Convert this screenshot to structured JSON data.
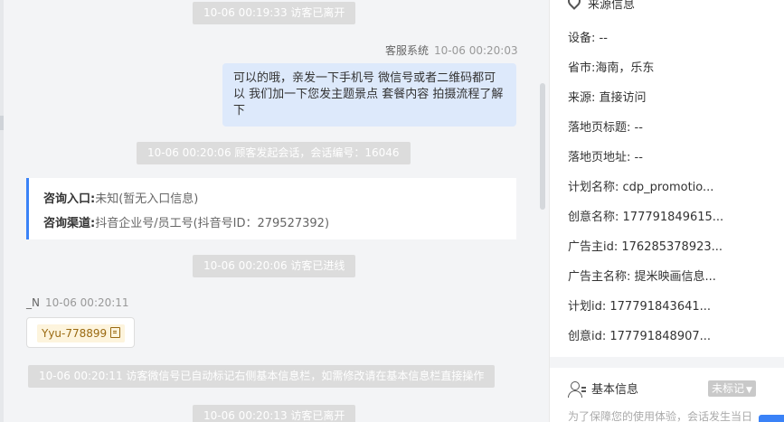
{
  "chat": {
    "system_top": "10-06 00:19:33 访客已离开",
    "agent_name": "客服系统",
    "agent_time": "10-06 00:20:03",
    "agent_message": "可以的哦，亲发一下手机号 微信号或者二维码都可以 我们加一下您发主题景点 套餐内容 拍摄流程了解下",
    "session_start": "10-06 00:20:06 顾客发起会话，会话编号：16046",
    "card": {
      "entry_label": "咨询入口:",
      "entry_value": "未知(暂无入口信息)",
      "channel_label": "咨询渠道:",
      "channel_value": "抖音企业号/员工号(抖音号ID：279527392)"
    },
    "visitor_enter": "10-06 00:20:06 访客已进线",
    "visitor_name": "_N",
    "visitor_time": "10-06 00:20:11",
    "wechat_tag": "Yyu-778899",
    "auto_mark": "10-06 00:20:11 访客微信号已自动标记右侧基本信息栏，如需修改请在基本信息栏直接操作",
    "system_bottom": "10-06 00:20:13 访客已离开"
  },
  "side": {
    "source_title": "来源信息",
    "rows": [
      {
        "k": "设备:",
        "v": "--"
      },
      {
        "k": "省市:",
        "v": "海南，乐东"
      },
      {
        "k": "来源:",
        "v": "直接访问"
      },
      {
        "k": "落地页标题:",
        "v": "--"
      },
      {
        "k": "落地页地址:",
        "v": "--"
      },
      {
        "k": "计划名称:",
        "v": "cdp_promotio..."
      },
      {
        "k": "创意名称:",
        "v": "177791849615..."
      },
      {
        "k": "广告主id:",
        "v": "176285378923..."
      },
      {
        "k": "广告主名称:",
        "v": "提米映画信息..."
      },
      {
        "k": "计划id:",
        "v": "177791843641..."
      },
      {
        "k": "创意id:",
        "v": "177791848907..."
      }
    ],
    "basic_title": "基本信息",
    "unmarked_label": "未标记",
    "tip": "为了保障您的使用体验，会话发生当日"
  }
}
